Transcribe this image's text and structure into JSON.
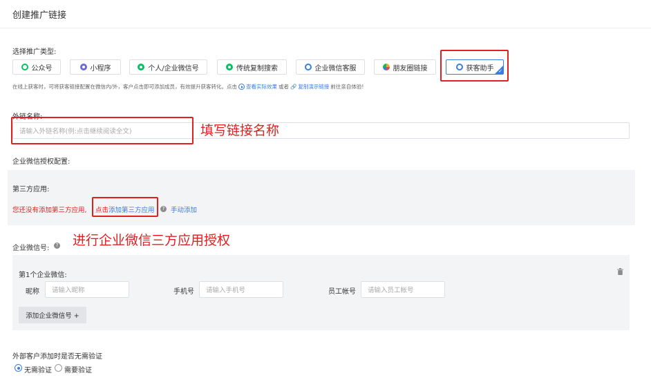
{
  "page": {
    "title": "创建推广链接"
  },
  "promo_type": {
    "label": "选择推广类型:",
    "options": [
      {
        "label": "公众号",
        "icon": "official-account-icon"
      },
      {
        "label": "小程序",
        "icon": "mini-program-icon"
      },
      {
        "label": "个人/企业微信号",
        "icon": "wechat-personal-icon"
      },
      {
        "label": "传统复制搜索",
        "icon": "wechat-search-icon"
      },
      {
        "label": "企业微信客服",
        "icon": "wecom-service-icon"
      },
      {
        "label": "朋友圈链接",
        "icon": "moments-icon"
      },
      {
        "label": "获客助手",
        "icon": "customer-assistant-icon",
        "selected": true
      }
    ],
    "desc": "在线上获客时，可将获客链接配置在微信内/外，客户点击即可添加成员，有效提升获客转化。点击",
    "view_effect": "查看实际效果",
    "or": "或者",
    "copy_demo": "复制演示链接",
    "tail": "前往亲自体验!"
  },
  "link_name": {
    "label": "外链名称:",
    "placeholder": "请输入外链名称(例:点击继续阅读全文)",
    "annotation": "填写链接名称"
  },
  "wecom_auth": {
    "label": "企业微信授权配置:",
    "third_party_label": "第三方应用:",
    "no_app_text": "您还没有添加第三方应用,",
    "click_text": "点击",
    "add_app_link": "添加第三方应用",
    "manual_add": "手动添加",
    "annotation": "进行企业微信三方应用授权"
  },
  "wecom_accounts": {
    "label": "企业微信号:",
    "item_title": "第1个企业微信:",
    "nickname_label": "昵称",
    "nickname_placeholder": "请输入昵称",
    "phone_label": "手机号",
    "phone_placeholder": "请输入手机号",
    "employee_label": "员工帐号",
    "employee_placeholder": "请输入员工帐号",
    "add_button": "添加企业微信号 +"
  },
  "verification": {
    "label": "外部客户添加时是否无需验证",
    "options": [
      {
        "label": "无需验证",
        "checked": true
      },
      {
        "label": "需要验证",
        "checked": false
      }
    ]
  },
  "colors": {
    "accent": "#3b7ddd",
    "annotation_red": "#e02020",
    "wechat_green": "#07c160",
    "panel_gray": "#f3f4f6"
  }
}
